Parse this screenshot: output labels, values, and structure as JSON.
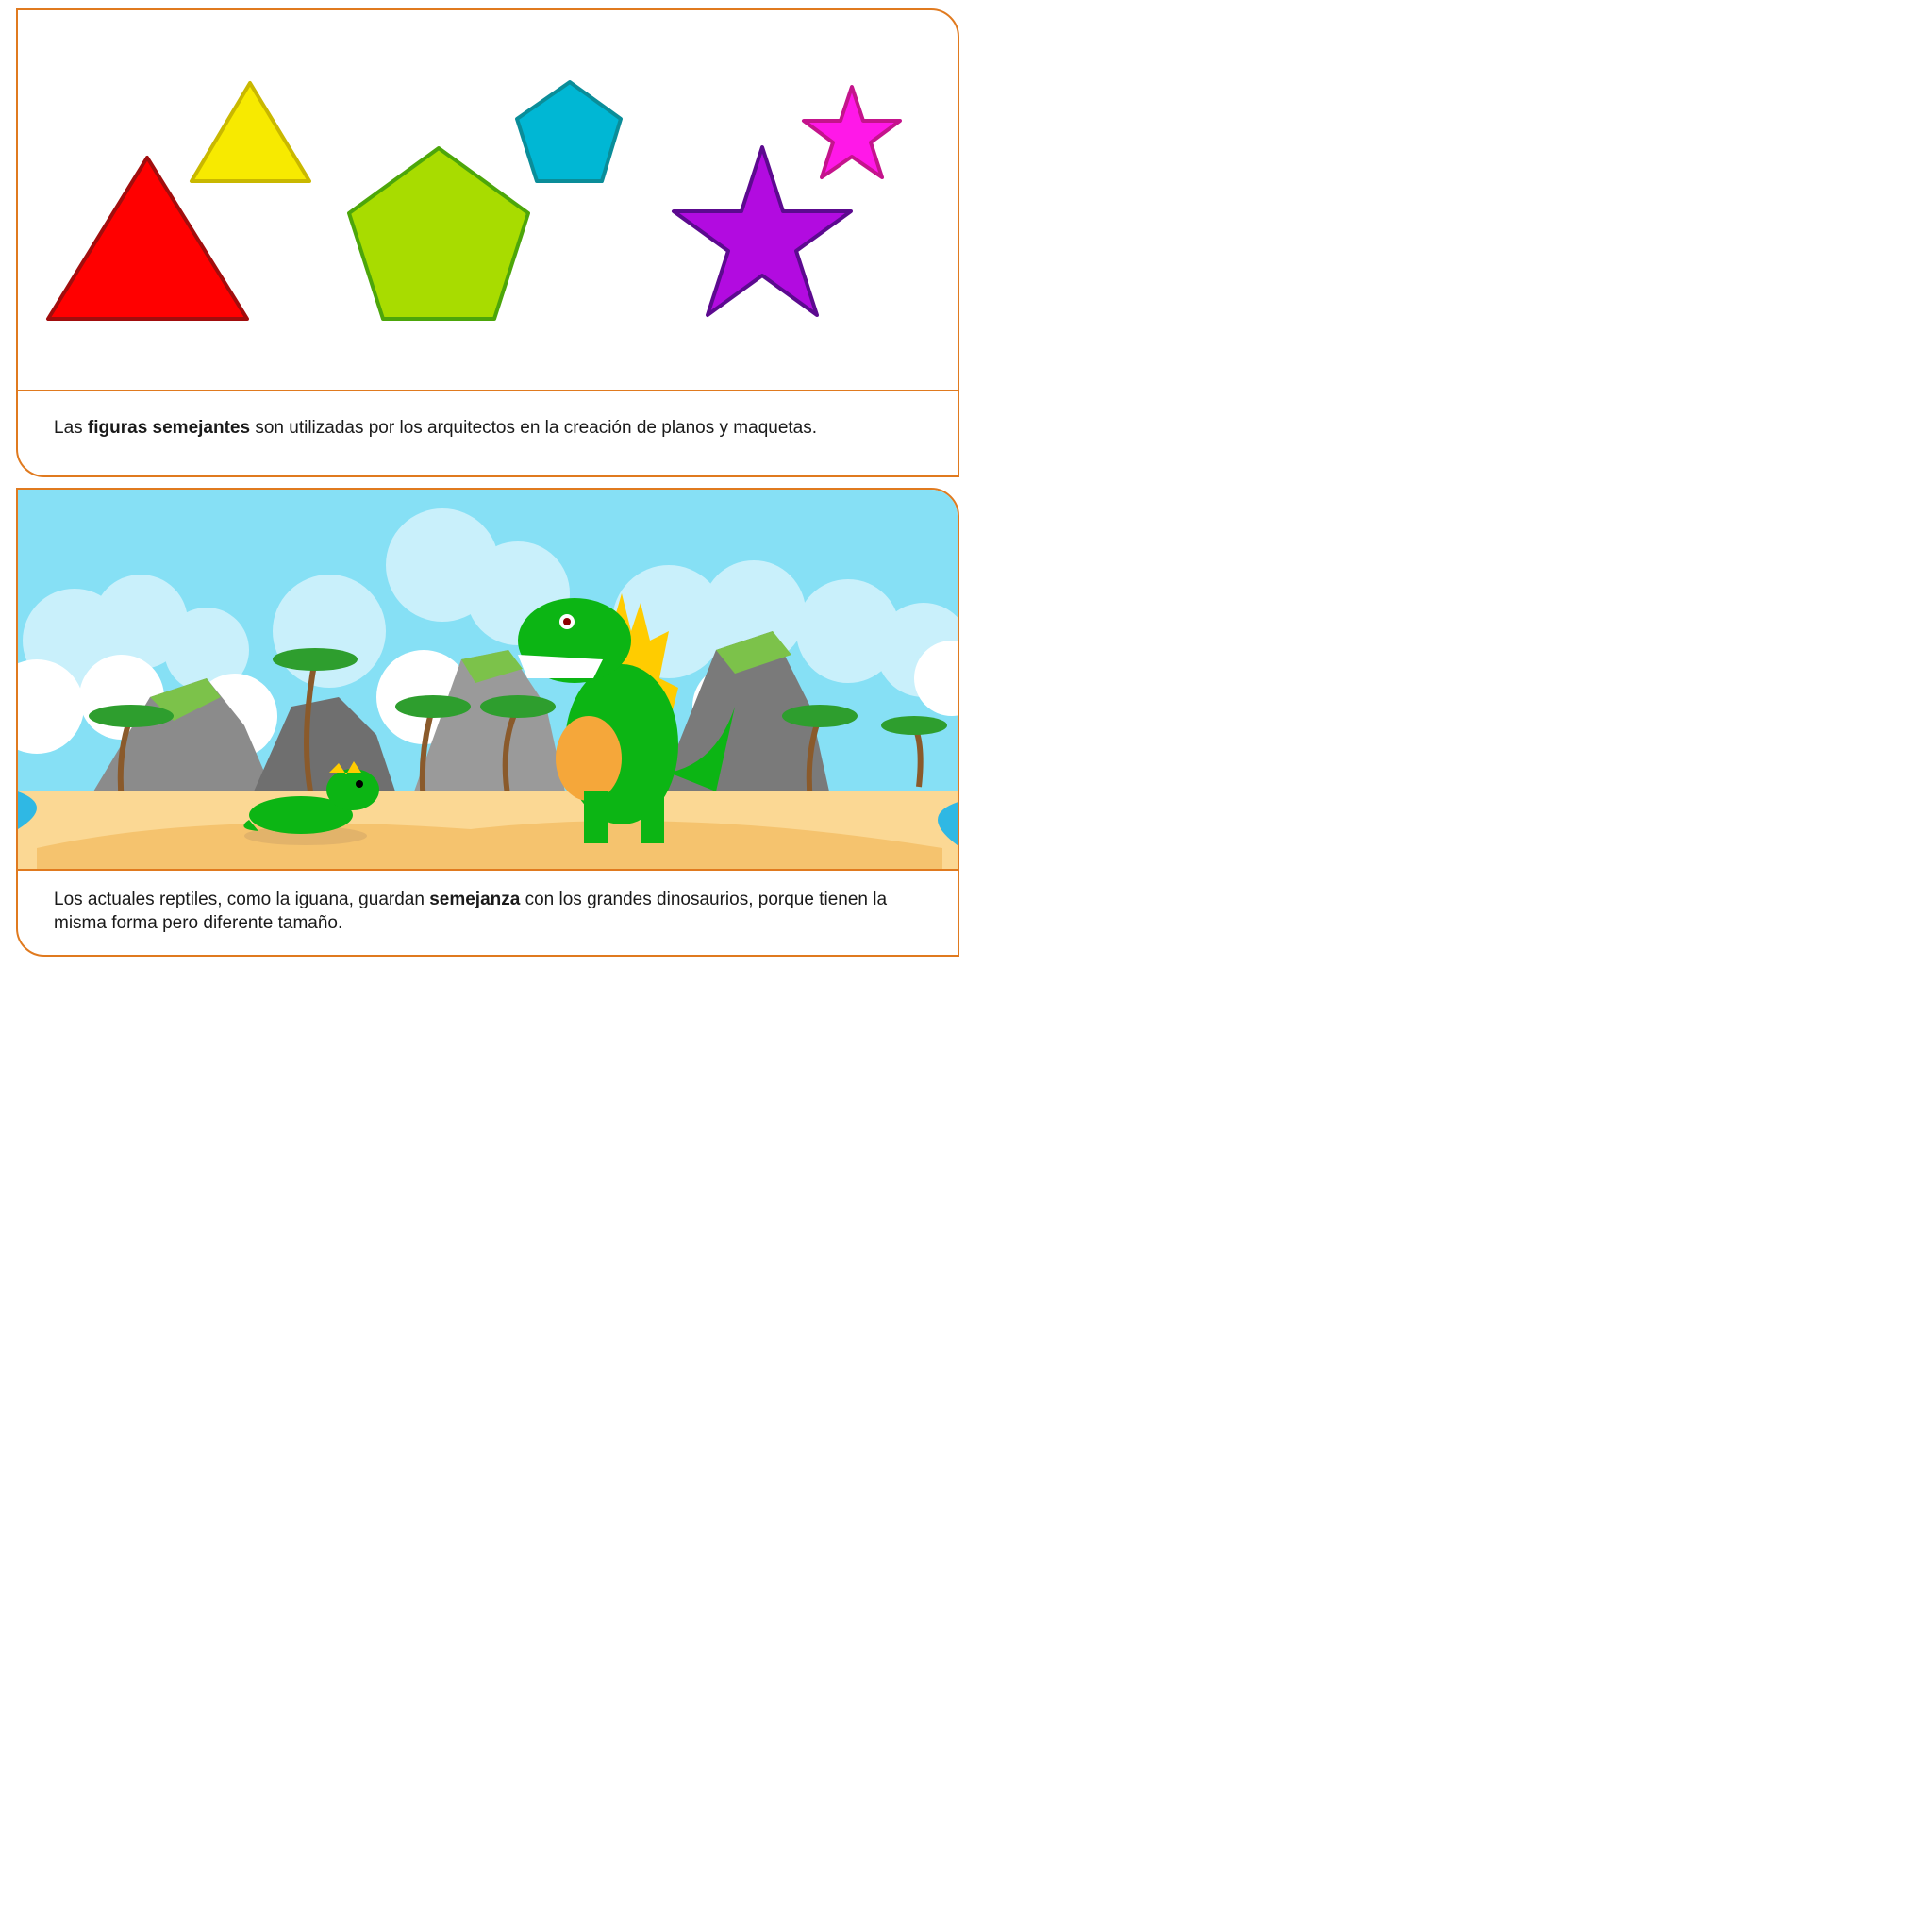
{
  "cards": [
    {
      "caption": {
        "part1": "Las ",
        "bold": "figuras semejantes",
        "part2": " son utilizadas por los arquitectos en la creación de planos y maquetas."
      },
      "shapes": [
        {
          "name": "large red triangle",
          "fill": "#ff0000",
          "stroke": "#a10d0d"
        },
        {
          "name": "small yellow triangle",
          "fill": "#f7ea00",
          "stroke": "#c9b800"
        },
        {
          "name": "large green pentagon",
          "fill": "#a8dc00",
          "stroke": "#4ca60a"
        },
        {
          "name": "small cyan pentagon",
          "fill": "#00b7d4",
          "stroke": "#0a8d99"
        },
        {
          "name": "large purple star",
          "fill": "#b20be0",
          "stroke": "#5c0a8f"
        },
        {
          "name": "small magenta star",
          "fill": "#ff18e8",
          "stroke": "#c4148c"
        }
      ]
    },
    {
      "caption": {
        "part1": "Los actuales reptiles, como la iguana, guardan ",
        "bold": "semejanza",
        "part2": " con los grandes dinosaurios, porque tienen la misma forma pero diferente tamaño."
      },
      "scene": {
        "sky": "#86e0f5",
        "sand": "#fbd894",
        "water": "#2fb8e4",
        "rock": "#8b8b8b",
        "dino": "#0cb514"
      }
    }
  ]
}
